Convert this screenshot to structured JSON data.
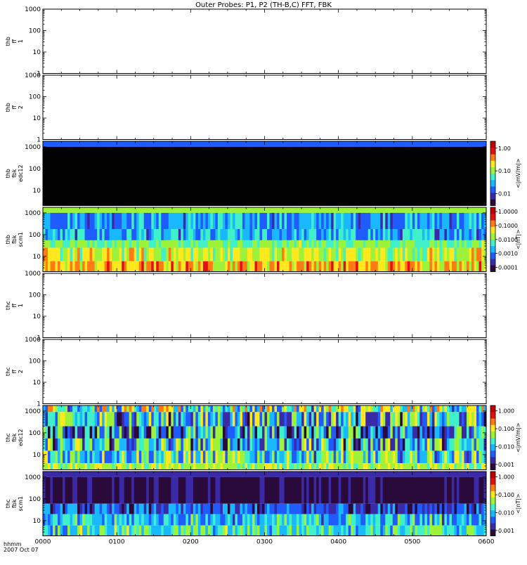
{
  "title": "Outer Probes: P1, P2 (TH-B,C) FFT, FBK",
  "time_axis": {
    "ticks": [
      "0000",
      "0100",
      "0200",
      "0300",
      "0400",
      "0500",
      "0600"
    ],
    "label_line1": "hhmm",
    "label_line2": "2007 Oct 07"
  },
  "colorbar_colors": [
    "#2a0a3a",
    "#3a2aa8",
    "#1f5cff",
    "#19b8ff",
    "#3ff0c8",
    "#9df23a",
    "#ffe81e",
    "#ff7a14",
    "#e0100e",
    "#c00000"
  ],
  "panels": [
    {
      "id": "thb-ff1",
      "label": [
        "thb",
        "ff",
        "1"
      ],
      "ylim": [
        1,
        1000
      ],
      "ticks": [
        "1",
        "10",
        "100",
        "1000"
      ],
      "kind": "empty"
    },
    {
      "id": "thb-ff2",
      "label": [
        "thb",
        "ff",
        "2"
      ],
      "ylim": [
        1,
        1000
      ],
      "ticks": [
        "1",
        "10",
        "100",
        "1000"
      ],
      "kind": "empty"
    },
    {
      "id": "thb-fbk-edc12",
      "label": [
        "thb",
        "fbk",
        "edc12"
      ],
      "ylim": [
        2,
        1800
      ],
      "ticks": [
        "10",
        "100",
        "1000"
      ],
      "kind": "spectrogram",
      "colorbar": {
        "unit": "<|mV/m|>",
        "ticks": [
          "0.01",
          "0.10",
          "1.00"
        ],
        "range": [
          0.003,
          2.0
        ]
      },
      "bands": [
        {
          "f": [
            1000,
            1800
          ],
          "level": 0.012,
          "var": 0.0
        },
        {
          "f": [
            2,
            1000
          ],
          "level": 0.0,
          "var": 0.0,
          "black": true
        }
      ]
    },
    {
      "id": "thb-fbk-scm1",
      "label": [
        "thb",
        "fbk",
        "scm1"
      ],
      "ylim": [
        2,
        1800
      ],
      "ticks": [
        "10",
        "100",
        "1000"
      ],
      "kind": "spectrogram",
      "colorbar": {
        "unit": "<|nT|>",
        "ticks": [
          "0.0001",
          "0.0010",
          "0.0100",
          "0.1000",
          "1.0000"
        ],
        "range": [
          5e-05,
          2.0
        ]
      },
      "bands": [
        {
          "f": [
            1000,
            1800
          ],
          "level": 0.018,
          "var": 0.15
        },
        {
          "f": [
            180,
            1000
          ],
          "level": 0.0015,
          "var": 0.6
        },
        {
          "f": [
            55,
            180
          ],
          "level": 0.0018,
          "var": 0.7
        },
        {
          "f": [
            25,
            55
          ],
          "level": 0.012,
          "var": 0.4
        },
        {
          "f": [
            6,
            25
          ],
          "level": 0.025,
          "var": 0.6
        },
        {
          "f": [
            2,
            6
          ],
          "level": 0.08,
          "var": 0.6
        }
      ]
    },
    {
      "id": "thc-ff1",
      "label": [
        "thc",
        "ff",
        "1"
      ],
      "ylim": [
        1,
        1000
      ],
      "ticks": [
        "1",
        "10",
        "100",
        "1000"
      ],
      "kind": "empty"
    },
    {
      "id": "thc-ff2",
      "label": [
        "thc",
        "ff",
        "2"
      ],
      "ylim": [
        1,
        1000
      ],
      "ticks": [
        "1",
        "10",
        "100",
        "1000"
      ],
      "kind": "empty"
    },
    {
      "id": "thc-fbk-edc12",
      "label": [
        "thc",
        "fbk",
        "edc12"
      ],
      "ylim": [
        2,
        1800
      ],
      "ticks": [
        "10",
        "100",
        "1000"
      ],
      "kind": "spectrogram",
      "colorbar": {
        "unit": "<|mV/m|>",
        "ticks": [
          "0.001",
          "0.010",
          "0.100",
          "1.000"
        ],
        "range": [
          0.0005,
          2.0
        ]
      },
      "bands": [
        {
          "f": [
            900,
            1800
          ],
          "level": 0.03,
          "var": 1.1
        },
        {
          "f": [
            200,
            900
          ],
          "level": 0.012,
          "var": 1.1
        },
        {
          "f": [
            55,
            200
          ],
          "level": 0.006,
          "var": 1.1
        },
        {
          "f": [
            15,
            55
          ],
          "level": 0.01,
          "var": 1.1
        },
        {
          "f": [
            4,
            15
          ],
          "level": 0.02,
          "var": 0.9
        },
        {
          "f": [
            2,
            4
          ],
          "level": 0.05,
          "var": 0.3
        }
      ]
    },
    {
      "id": "thc-fbk-scm1",
      "label": [
        "thc",
        "fbk",
        "scm1"
      ],
      "ylim": [
        2,
        1800
      ],
      "ticks": [
        "10",
        "100",
        "1000"
      ],
      "kind": "spectrogram",
      "colorbar": {
        "unit": "<|nT|>",
        "ticks": [
          "0.001",
          "0.010",
          "0.100",
          "1.000"
        ],
        "range": [
          0.0005,
          2.0
        ]
      },
      "bands": [
        {
          "f": [
            1000,
            1800
          ],
          "level": 0.0012,
          "var": 0.0
        },
        {
          "f": [
            60,
            1000
          ],
          "level": 0.0006,
          "var": 0.5
        },
        {
          "f": [
            20,
            60
          ],
          "level": 0.003,
          "var": 0.6
        },
        {
          "f": [
            6,
            20
          ],
          "level": 0.01,
          "var": 0.6
        },
        {
          "f": [
            2,
            6
          ],
          "level": 0.02,
          "var": 0.6
        }
      ]
    }
  ],
  "chart_data": {
    "type": "heatmap",
    "title": "Outer Probes: P1, P2 (TH-B,C) FFT, FBK",
    "xlabel": "hhmm 2007 Oct 07",
    "x_ticks": [
      "0000",
      "0100",
      "0200",
      "0300",
      "0400",
      "0500",
      "0600"
    ],
    "x_range": [
      "0000",
      "0600"
    ],
    "yscale": "log",
    "panels": [
      "thb ff 1",
      "thb ff 2",
      "thb fbk edc12",
      "thb fbk scm1",
      "thc ff 1",
      "thc ff 2",
      "thc fbk edc12",
      "thc fbk scm1"
    ],
    "empty_panels": [
      "thb ff 1",
      "thb ff 2",
      "thc ff 1",
      "thc ff 2"
    ]
  }
}
